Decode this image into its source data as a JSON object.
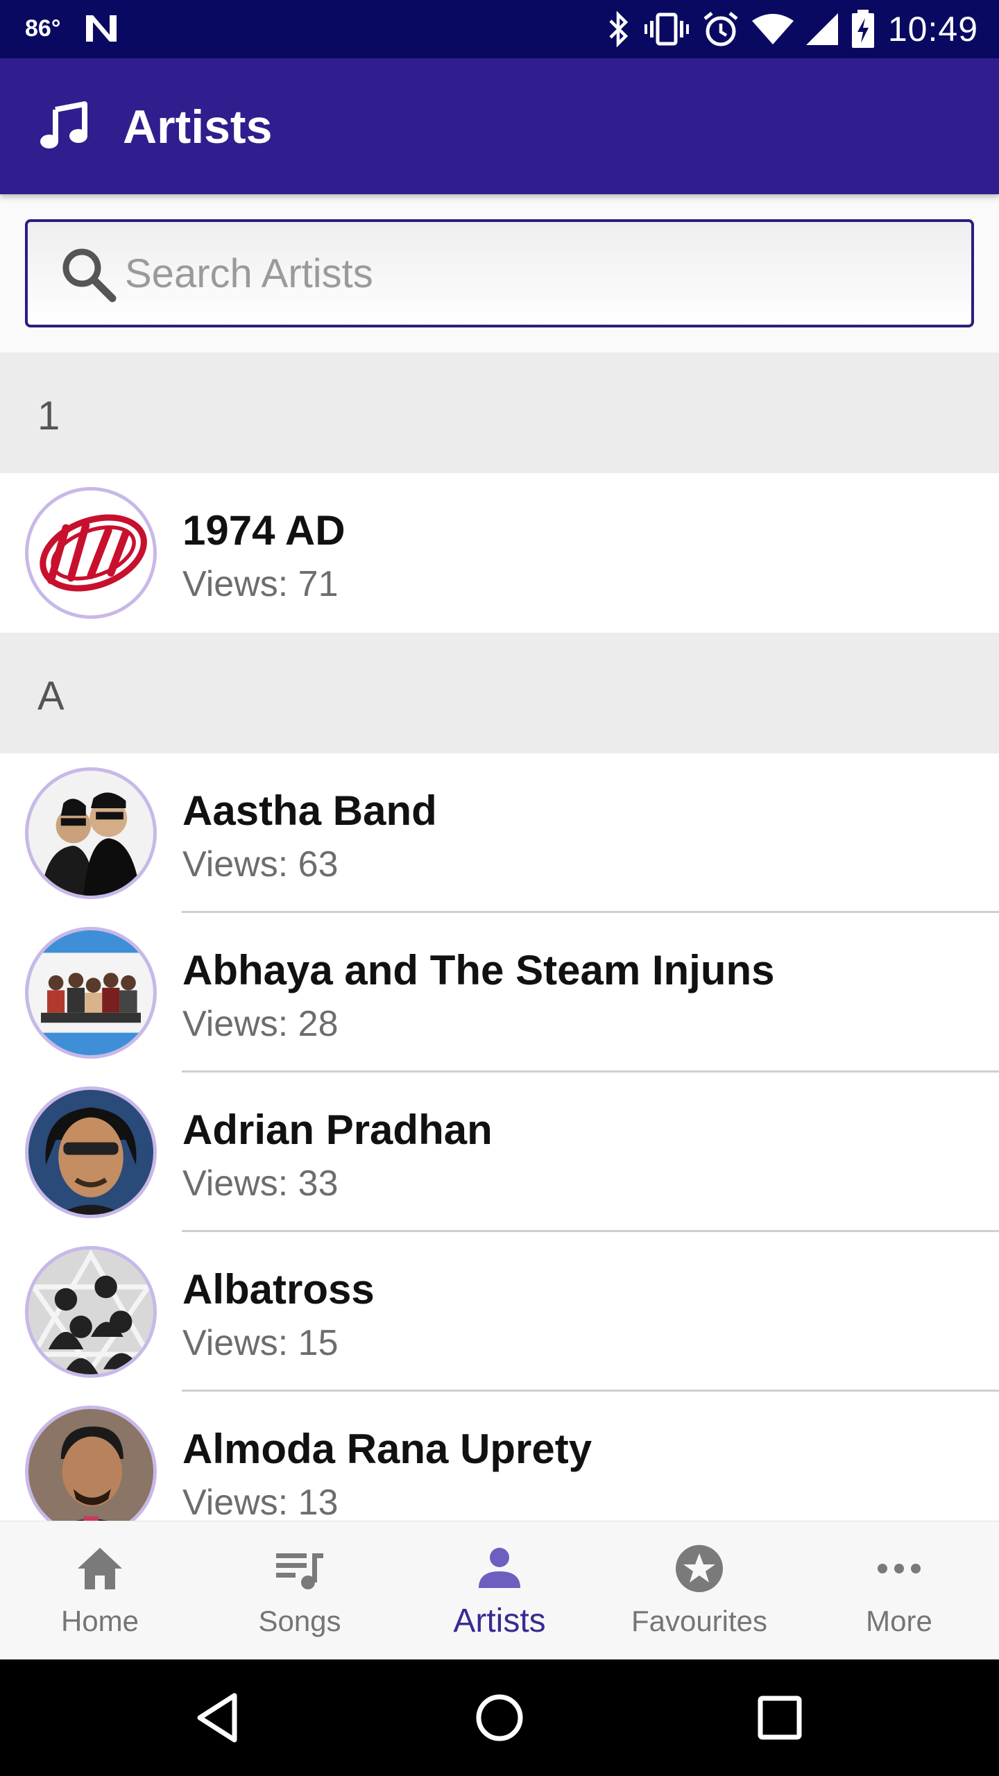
{
  "status_bar": {
    "temperature": "86°",
    "time": "10:49",
    "icons": [
      "n-notification-icon",
      "bluetooth-icon",
      "vibrate-icon",
      "alarm-icon",
      "wifi-icon",
      "signal-icon",
      "battery-charging-icon"
    ]
  },
  "app_bar": {
    "icon": "music-note-icon",
    "title": "Artists",
    "background": "#301e8e"
  },
  "search": {
    "placeholder": "Search Artists",
    "value": ""
  },
  "sections": [
    {
      "header": "1",
      "artists": [
        {
          "name": "1974 AD",
          "views": "Views: 71"
        }
      ]
    },
    {
      "header": "A",
      "artists": [
        {
          "name": "Aastha Band",
          "views": "Views: 63"
        },
        {
          "name": "Abhaya and The Steam Injuns",
          "views": "Views: 28"
        },
        {
          "name": "Adrian Pradhan",
          "views": "Views: 33"
        },
        {
          "name": "Albatross",
          "views": "Views: 15"
        },
        {
          "name": "Almoda Rana Uprety",
          "views": "Views: 13"
        }
      ]
    }
  ],
  "bottom_nav": {
    "active": "Artists",
    "active_color": "#372b93",
    "items": [
      {
        "label": "Home",
        "icon": "home-icon"
      },
      {
        "label": "Songs",
        "icon": "queue-music-icon"
      },
      {
        "label": "Artists",
        "icon": "person-icon"
      },
      {
        "label": "Favourites",
        "icon": "star-circle-icon"
      },
      {
        "label": "More",
        "icon": "more-horizontal-icon"
      }
    ]
  },
  "system_nav": {
    "icons": [
      "back-icon",
      "home-circle-icon",
      "recents-icon"
    ]
  }
}
